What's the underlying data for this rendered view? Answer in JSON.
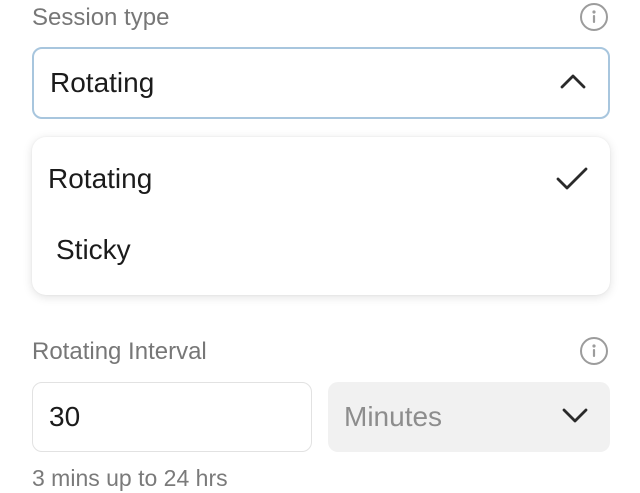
{
  "session_type": {
    "label": "Session type",
    "info_icon": "info-icon",
    "selected_value": "Rotating",
    "chevron_icon": "chevron-up-icon",
    "focus_border_color": "#a8c6de",
    "options": [
      {
        "label": "Rotating",
        "selected": true,
        "check_icon": "checkmark-icon"
      },
      {
        "label": "Sticky",
        "selected": false
      }
    ]
  },
  "rotating_interval": {
    "label": "Rotating Interval",
    "info_icon": "info-icon",
    "value": "30",
    "unit_value": "Minutes",
    "unit_chevron_icon": "chevron-down-icon",
    "hint": "3 mins up to 24 hrs"
  }
}
